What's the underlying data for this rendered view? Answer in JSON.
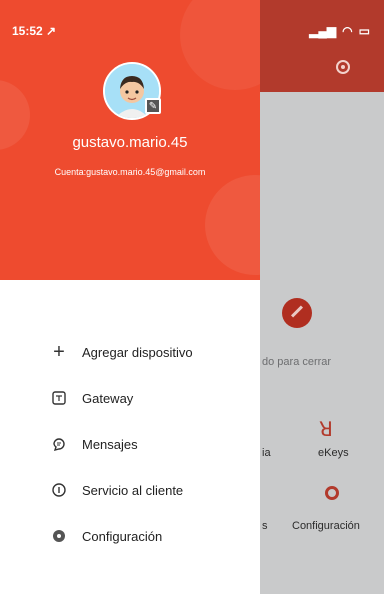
{
  "status_bar": {
    "time": "15:52 ↗"
  },
  "profile": {
    "username": "gustavo.mario.45",
    "account": "Cuenta:gustavo.mario.45@gmail.com"
  },
  "menu": {
    "items": [
      {
        "label": "Agregar dispositivo",
        "icon": "plus-icon"
      },
      {
        "label": "Gateway",
        "icon": "gateway-icon"
      },
      {
        "label": "Mensajes",
        "icon": "message-icon"
      },
      {
        "label": "Servicio al cliente",
        "icon": "info-icon"
      },
      {
        "label": "Configuración",
        "icon": "settings-icon"
      }
    ]
  },
  "background": {
    "partial_text": "do para cerrar",
    "grid_labels": [
      "ia",
      "eKeys",
      "s",
      "Configuración"
    ]
  },
  "colors": {
    "drawer_header": "#ee4b2f",
    "app_header": "#b23a2c",
    "overlay": "#c9cacb"
  }
}
